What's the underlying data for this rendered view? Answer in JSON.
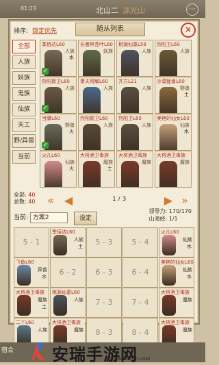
{
  "topbar": {
    "time": "01:23",
    "location": "北山二",
    "sublocation": "涤光山"
  },
  "panel": {
    "sort_label": "排序:",
    "lock_label": "锁定优先",
    "title": "随从列表",
    "close": "×"
  },
  "filters": [
    "全部",
    "人族",
    "妖族",
    "鬼族",
    "仙族",
    "天工",
    "野/异兽",
    "当前"
  ],
  "cards": [
    {
      "name": "季佰达L60",
      "race": "人族",
      "elem": "水",
      "checked": true,
      "color": "#7a6a55"
    },
    {
      "name": "长者林芸叶L60",
      "race": "妖族",
      "elem": "",
      "checked": false,
      "color": "#5f6b4a"
    },
    {
      "name": "桃源仙童L58",
      "race": "人族",
      "elem": "",
      "checked": false,
      "color": "#4f5560"
    },
    {
      "name": "烈阳卫L60",
      "race": "人族",
      "elem": "",
      "checked": false,
      "color": "#6b5a3a"
    },
    {
      "name": "烈阳箭卫L60",
      "race": "人族",
      "elem": "",
      "checked": true,
      "color": "#6a5b46"
    },
    {
      "name": "萧天将耀L60",
      "race": "人族",
      "elem": "",
      "checked": false,
      "color": "#4b6a8a"
    },
    {
      "name": "齐方L21",
      "race": "人族",
      "elem": "",
      "checked": false,
      "color": "#5a4f44"
    },
    {
      "name": "沙漠猛兽L60",
      "race": "野兽",
      "elem": "土",
      "checked": false,
      "color": "#8a6a40"
    },
    {
      "name": "当康L60",
      "race": "野兽",
      "elem": "火",
      "checked": true,
      "color": "#6b6a5a"
    },
    {
      "name": "烈阳箭卫L60",
      "race": "人族",
      "elem": "",
      "checked": false,
      "color": "#5b4a3a"
    },
    {
      "name": "烈阳卫L60",
      "race": "人族",
      "elem": "",
      "checked": false,
      "color": "#5a4f40"
    },
    {
      "name": "美艳的仙女L60",
      "race": "仙族",
      "elem": "水",
      "checked": false,
      "color": "#c7a07a"
    },
    {
      "name": "火儿L60",
      "race": "仙族",
      "elem": "火",
      "checked": false,
      "color": "#d18a8a"
    },
    {
      "name": "大将酒卫毒族",
      "race": "魔族",
      "elem": "土",
      "checked": false,
      "color": "#7a3a2a"
    },
    {
      "name": "大将酒卫毒族",
      "race": "魔族",
      "elem": "",
      "checked": false,
      "color": "#7a3a2a"
    },
    {
      "name": "大将酒卫毒族",
      "race": "魔族",
      "elem": "",
      "checked": false,
      "color": "#7a3a2a"
    }
  ],
  "stats": {
    "all_label": "全部:",
    "all": "40",
    "total_label": "总数:",
    "total": "40"
  },
  "pager": {
    "prev_fast": "«",
    "prev": "◀",
    "page": "1 / 3",
    "next": "▶",
    "next_fast": "»"
  },
  "scheme": {
    "label": "当前:",
    "value": "方案2",
    "button": "设定"
  },
  "lead": {
    "leadership_label": "领导力:",
    "leadership": "170/170",
    "mountain_label": "山海经:",
    "mountain": "1/1"
  },
  "formation": [
    {
      "label": "5 - 1",
      "filled": false
    },
    {
      "name": "季佰达L60",
      "race": "人族",
      "elem": "土",
      "filled": true,
      "color": "#7a6a55"
    },
    {
      "label": "5 - 3",
      "filled": false
    },
    {
      "label": "5 - 4",
      "filled": false
    },
    {
      "name": "火儿L60",
      "race": "仙族",
      "elem": "水",
      "filled": true,
      "color": "#d18a8a"
    },
    {
      "name": "飞鱼L60",
      "race": "异兽",
      "elem": "水",
      "filled": true,
      "color": "#6b8aa8"
    },
    {
      "label": "6 - 2",
      "filled": false
    },
    {
      "label": "6 - 3",
      "filled": false
    },
    {
      "label": "6 - 4",
      "filled": false
    },
    {
      "name": "美艳的仙女L60",
      "race": "仙族",
      "elem": "水",
      "filled": true,
      "color": "#c7a07a"
    },
    {
      "name": "大将酒卫毒族",
      "race": "魔族",
      "elem": "土",
      "filled": true,
      "color": "#7a3a2a"
    },
    {
      "name": "桃源仙童L60",
      "race": "人族",
      "elem": "",
      "filled": true,
      "color": "#4f5560"
    },
    {
      "label": "7 - 3",
      "filled": false
    },
    {
      "label": "7 - 4",
      "filled": false
    },
    {
      "name": "大将酒卫毒族",
      "race": "魔族",
      "elem": "",
      "filled": true,
      "color": "#7a3a2a"
    },
    {
      "name": "二丫L60",
      "race": "人族",
      "elem": "",
      "filled": true,
      "color": "#5a7a8a"
    },
    {
      "name": "大将酒卫毒族",
      "race": "魔族",
      "elem": "",
      "filled": true,
      "color": "#7a3a2a"
    },
    {
      "label": "8 - 3",
      "filled": false
    },
    {
      "label": "8 - 4",
      "filled": false
    },
    {
      "name": "大将酒卫毒族",
      "race": "魔族",
      "elem": "",
      "filled": true,
      "color": "#7a3a2a"
    }
  ],
  "watermark": {
    "text": "安瑞手游网",
    "url": "www.szergh.com",
    "corner": "宿合"
  },
  "colors": {
    "accent": "#c2301d",
    "panel": "#f4eddc",
    "border": "#8b7a5a"
  }
}
